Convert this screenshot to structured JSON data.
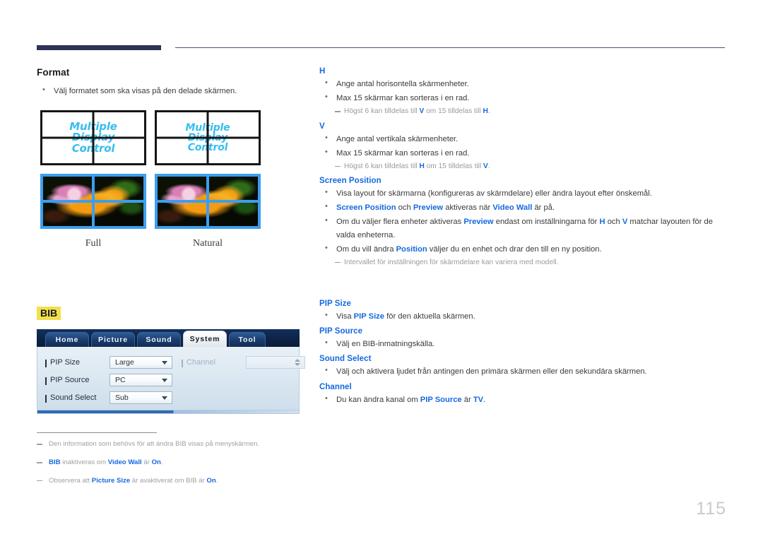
{
  "page": {
    "number": "115"
  },
  "left": {
    "format": {
      "heading": "Format",
      "bullets": [
        "Välj formatet som ska visas på den delade skärmen."
      ],
      "diagrams": [
        {
          "label": "Full",
          "overlay_lines": [
            "Multiple",
            "Display",
            "Control"
          ]
        },
        {
          "label": "Natural",
          "overlay_lines": [
            "Multiple",
            "Display",
            "Control"
          ]
        }
      ]
    },
    "pip": {
      "heading": "BIB",
      "osd": {
        "tabs": [
          {
            "label": "Home",
            "active": false
          },
          {
            "label": "Picture",
            "active": false
          },
          {
            "label": "Sound",
            "active": false
          },
          {
            "label": "System",
            "active": true
          },
          {
            "label": "Tool",
            "active": false
          }
        ],
        "rows": [
          {
            "label": "PIP Size",
            "value": "Large",
            "disabled": false
          },
          {
            "label": "PIP Source",
            "value": "PC",
            "disabled": false
          },
          {
            "label": "Sound Select",
            "value": "Sub",
            "disabled": false
          }
        ],
        "right_rows": [
          {
            "label": "Channel",
            "value": "",
            "disabled": true
          }
        ]
      },
      "footnotes": [
        {
          "text": "Den information som behövs för att ändra BIB visas på menyskärmen.",
          "html": "Den information som behövs för att ändra BIB visas på menyskärmen."
        },
        {
          "text": "BIB inaktiveras om Video Wall är On.",
          "html": "<b>BIB</b> inaktiveras om <b>Video Wall</b> är <b>On</b>."
        },
        {
          "text": "Observera att Picture Size är avaktiverat om BIB är On.",
          "html": "Observera att <b>Picture Size</b> är avaktiverat om BIB är <b>On</b>."
        }
      ]
    }
  },
  "right": {
    "sections": [
      {
        "heading": "H",
        "bullets": [
          {
            "html": "Ange antal horisontella skärmenheter."
          },
          {
            "html": "Max 15 skärmar kan sorteras i en rad."
          }
        ],
        "notes": [
          {
            "html": "Högst 6 kan tilldelas till <b>V</b> om 15 tilldelas till <b>H</b>."
          }
        ]
      },
      {
        "heading": "V",
        "bullets": [
          {
            "html": "Ange antal vertikala skärmenheter."
          },
          {
            "html": "Max 15 skärmar kan sorteras i en rad."
          }
        ],
        "notes": [
          {
            "html": "Högst 6 kan tilldelas till <b>H</b> om 15 tilldelas till <b>V</b>."
          }
        ]
      },
      {
        "heading": "Screen Position",
        "bullets": [
          {
            "html": "Visa layout för skärmarna (konfigureras av skärmdelare) eller ändra layout efter önskemål."
          },
          {
            "html": "<b>Screen Position</b> och <b>Preview</b> aktiveras när <b>Video Wall</b> är på."
          },
          {
            "html": "Om du väljer flera enheter aktiveras <b>Preview</b> endast om inställningarna för <b>H</b> och <b>V</b> matchar layouten för de valda enheterna."
          },
          {
            "html": "Om du vill ändra <b>Position</b> väljer du en enhet och drar den till en ny position."
          }
        ],
        "notes": [
          {
            "html": "Intervallet för inställningen för skärmdelare kan variera med modell."
          }
        ]
      },
      {
        "heading": "PIP Size",
        "bullets": [
          {
            "html": "Visa <b>PIP Size</b> för den aktuella skärmen."
          }
        ],
        "notes": []
      },
      {
        "heading": "PIP Source",
        "bullets": [
          {
            "html": "Välj en BIB-inmatningskälla."
          }
        ],
        "notes": []
      },
      {
        "heading": "Sound Select",
        "bullets": [
          {
            "html": "Välj och aktivera ljudet från antingen den primära skärmen eller den sekundära skärmen."
          }
        ],
        "notes": []
      },
      {
        "heading": "Channel",
        "bullets": [
          {
            "html": "Du kan ändra kanal om <b>PIP Source</b> är <b>TV</b>."
          }
        ],
        "notes": []
      }
    ]
  },
  "colors": {
    "accent_blue": "#1569e0",
    "header_navy": "#2e3256",
    "highlight_yellow": "#f2e04e",
    "note_gray": "#9a9a9a",
    "page_num_gray": "#c9c9c9"
  }
}
